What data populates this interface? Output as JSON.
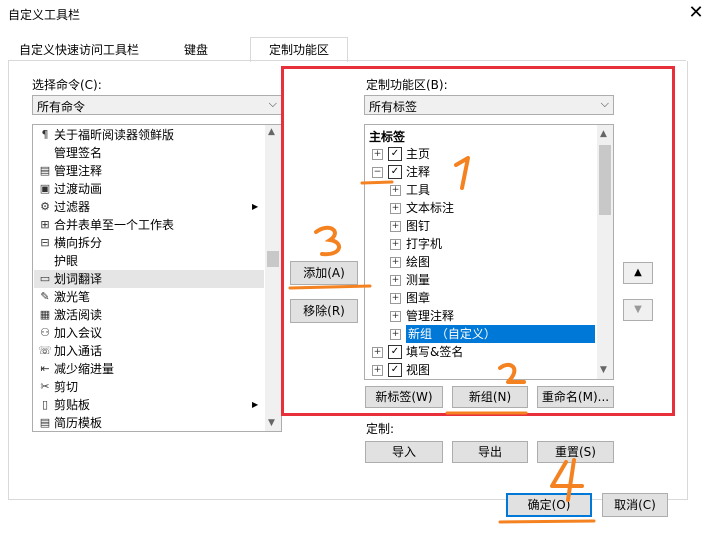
{
  "window": {
    "title": "自定义工具栏",
    "close_glyph": "✕"
  },
  "tabs": [
    {
      "label": "自定义快速访问工具栏"
    },
    {
      "label": "键盘"
    },
    {
      "label": "定制功能区"
    }
  ],
  "left": {
    "label": "选择命令(C):",
    "combo_value": "所有命令",
    "items": [
      {
        "label": "关于福昕阅读器领鲜版",
        "icon": "about-icon"
      },
      {
        "label": "管理签名",
        "icon": ""
      },
      {
        "label": "管理注释",
        "icon": "manage-comments-icon"
      },
      {
        "label": "过渡动画",
        "icon": "transition-icon"
      },
      {
        "label": "过滤器",
        "icon": "filter-icon",
        "submenu": true
      },
      {
        "label": "合并表单至一个工作表",
        "icon": "merge-form-icon"
      },
      {
        "label": "横向拆分",
        "icon": "split-horizontal-icon"
      },
      {
        "label": "护眼",
        "icon": ""
      },
      {
        "label": "划词翻译",
        "icon": "translate-icon",
        "selected": true
      },
      {
        "label": "激光笔",
        "icon": "laser-pen-icon"
      },
      {
        "label": "激活阅读",
        "icon": "active-reading-icon"
      },
      {
        "label": "加入会议",
        "icon": "join-meeting-icon"
      },
      {
        "label": "加入通话",
        "icon": "join-call-icon"
      },
      {
        "label": "减少缩进量",
        "icon": "decrease-indent-icon"
      },
      {
        "label": "剪切",
        "icon": "cut-icon"
      },
      {
        "label": "剪贴板",
        "icon": "clipboard-icon",
        "submenu": true
      },
      {
        "label": "简历模板",
        "icon": "resume-template-icon"
      }
    ]
  },
  "middle": {
    "add_label": "添加(A)",
    "remove_label": "移除(R)"
  },
  "right": {
    "label": "定制功能区(B):",
    "combo_value": "所有标签",
    "tree_header": "主标签",
    "tree": [
      {
        "label": "主页",
        "level": 0,
        "expander": "+",
        "checked": true
      },
      {
        "label": "注释",
        "level": 0,
        "expander": "−",
        "checked": true
      },
      {
        "label": "工具",
        "level": 1,
        "expander": "+"
      },
      {
        "label": "文本标注",
        "level": 1,
        "expander": "+"
      },
      {
        "label": "图钉",
        "level": 1,
        "expander": "+"
      },
      {
        "label": "打字机",
        "level": 1,
        "expander": "+"
      },
      {
        "label": "绘图",
        "level": 1,
        "expander": "+"
      },
      {
        "label": "测量",
        "level": 1,
        "expander": "+"
      },
      {
        "label": "图章",
        "level": 1,
        "expander": "+"
      },
      {
        "label": "管理注释",
        "level": 1,
        "expander": "+"
      },
      {
        "label": "新组 （自定义）",
        "level": 1,
        "expander": "+",
        "selected": true
      },
      {
        "label": "填写&签名",
        "level": 0,
        "expander": "+",
        "checked": true
      },
      {
        "label": "视图",
        "level": 0,
        "expander": "+",
        "checked": true
      }
    ],
    "new_tab_label": "新标签(W)",
    "new_group_label": "新组(N)",
    "rename_label": "重命名(M)...",
    "customize_label": "定制:",
    "import_label": "导入",
    "export_label": "导出",
    "reset_label": "重置(S)",
    "up_glyph": "▲",
    "down_glyph": "▼"
  },
  "footer": {
    "ok_label": "确定(O)",
    "cancel_label": "取消(C)"
  },
  "annotations": [
    {
      "text": "1",
      "color": "#f58220"
    },
    {
      "text": "2",
      "color": "#f58220"
    },
    {
      "text": "3",
      "color": "#f58220"
    },
    {
      "text": "4",
      "color": "#f58220"
    }
  ],
  "colors": {
    "highlight_box": "#e8303a",
    "selection_blue": "#0078d7",
    "annotation_orange": "#f58220"
  }
}
